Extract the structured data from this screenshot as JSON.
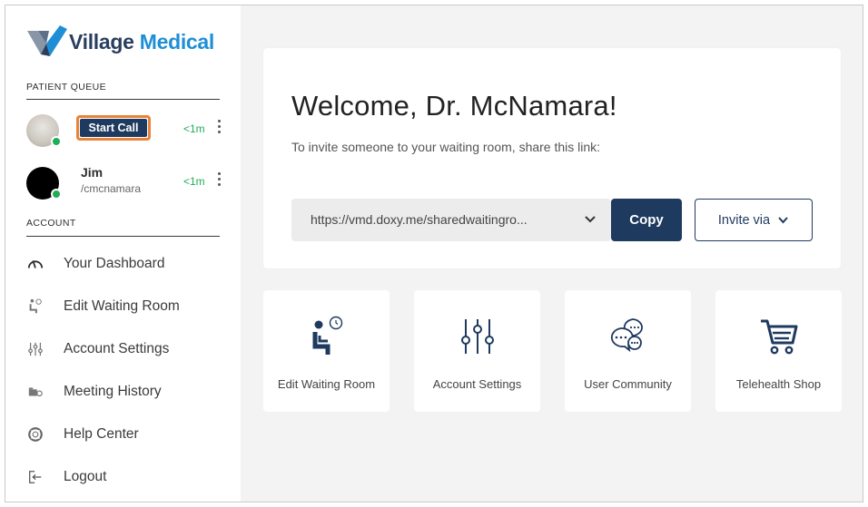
{
  "brand": {
    "name_part1": "Village",
    "name_part2": "Medical"
  },
  "sidebar": {
    "patient_queue_title": "PATIENT QUEUE",
    "queue": [
      {
        "action_label": "Start Call",
        "wait": "<1m"
      },
      {
        "name": "Jim",
        "handle": "/cmcnamara",
        "wait": "<1m"
      }
    ],
    "account_title": "ACCOUNT",
    "nav": [
      {
        "label": "Your Dashboard",
        "icon": "dashboard-gauge-icon"
      },
      {
        "label": "Edit Waiting Room",
        "icon": "waiting-room-chair-icon"
      },
      {
        "label": "Account Settings",
        "icon": "sliders-icon"
      },
      {
        "label": "Meeting History",
        "icon": "camera-history-icon"
      },
      {
        "label": "Help Center",
        "icon": "lifebuoy-icon"
      },
      {
        "label": "Logout",
        "icon": "logout-icon"
      }
    ]
  },
  "main": {
    "welcome_title": "Welcome, Dr. McNamara!",
    "invite_text": "To invite someone to your waiting room, share this link:",
    "room_link": "https://vmd.doxy.me/sharedwaitingro...",
    "copy_label": "Copy",
    "invite_label": "Invite via",
    "tiles": [
      {
        "label": "Edit Waiting Room",
        "icon": "waiting-room-chair-icon"
      },
      {
        "label": "Account Settings",
        "icon": "sliders-icon"
      },
      {
        "label": "User Community",
        "icon": "chat-bubbles-icon"
      },
      {
        "label": "Telehealth Shop",
        "icon": "shopping-cart-icon"
      }
    ]
  },
  "colors": {
    "navy": "#1f3a5f",
    "brand_blue": "#1e8fd6",
    "online_green": "#1fae57",
    "highlight_orange": "#e5843a",
    "background": "#f3f3f3"
  }
}
